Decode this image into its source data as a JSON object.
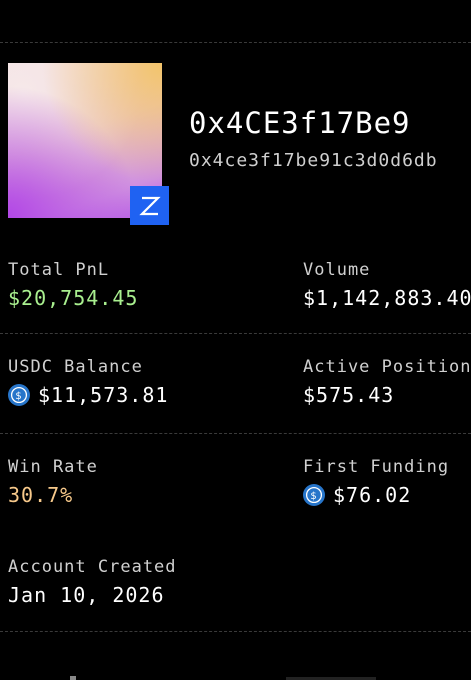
{
  "profile": {
    "address_short": "0x4CE3f17Be9",
    "address_full": "0x4ce3f17be91c3d0d6db",
    "badge_icon": "wallet-brand-icon"
  },
  "stats": {
    "total_pnl": {
      "label": "Total PnL",
      "value": "$20,754.45",
      "color": "#a9ef8f"
    },
    "volume": {
      "label": "Volume",
      "value": "$1,142,883.40"
    },
    "usdc_balance": {
      "label": "USDC Balance",
      "value": "$11,573.81",
      "icon": "usdc-coin-icon"
    },
    "active_positions": {
      "label": "Active Position",
      "value": "$575.43"
    },
    "win_rate": {
      "label": "Win Rate",
      "value": "30.7%",
      "color": "#f7c98b"
    },
    "first_funding": {
      "label": "First Funding",
      "value": "$76.02",
      "icon": "usdc-coin-icon"
    },
    "account_created": {
      "label": "Account Created",
      "value": "Jan 10, 2026"
    }
  },
  "colors": {
    "background": "#000000",
    "badge": "#1f62f2",
    "usdc": "#2775ca"
  }
}
